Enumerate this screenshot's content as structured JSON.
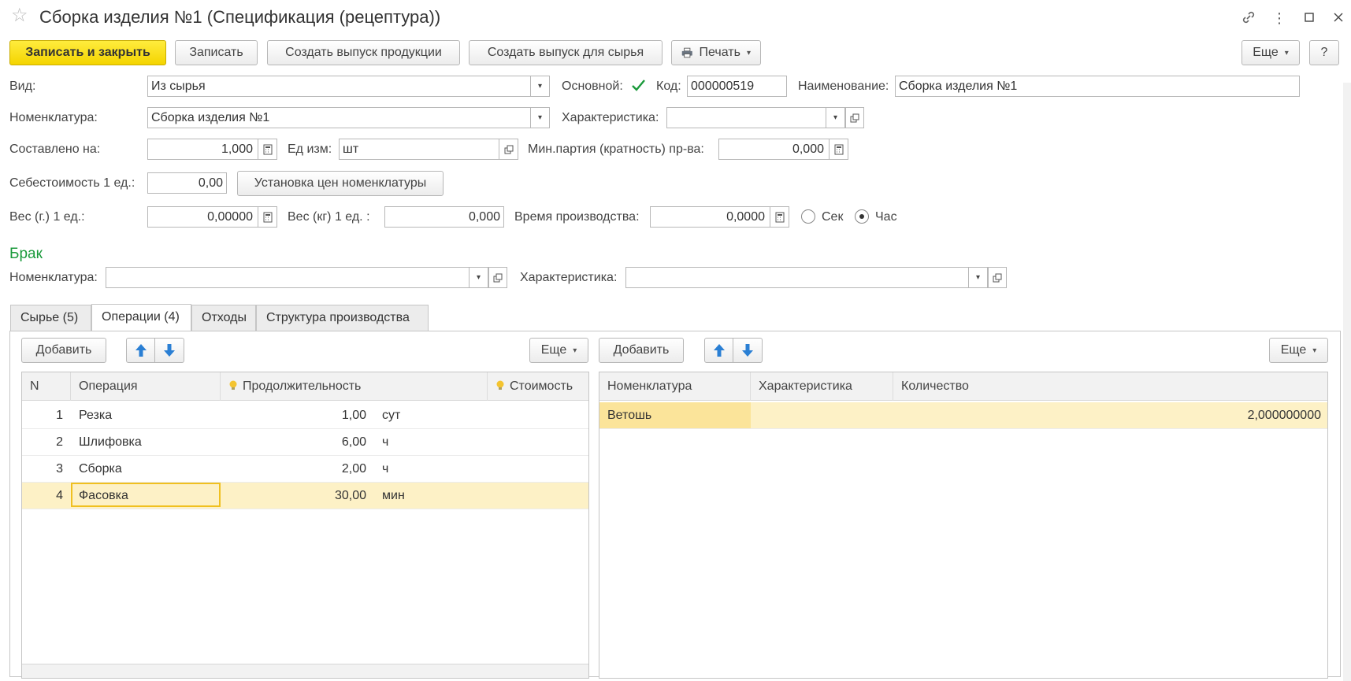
{
  "window": {
    "title": "Сборка изделия №1 (Спецификация (рецептура))"
  },
  "toolbar": {
    "save_close": "Записать и закрыть",
    "save": "Записать",
    "create_product_release": "Создать выпуск продукции",
    "create_raw_release": "Создать выпуск для сырья",
    "print": "Печать",
    "more": "Еще",
    "help": "?"
  },
  "form": {
    "vid_label": "Вид:",
    "vid_value": "Из сырья",
    "osnovnoy_label": "Основной:",
    "osnovnoy_checked": true,
    "kod_label": "Код:",
    "kod_value": "000000519",
    "naim_label": "Наименование:",
    "naim_value": "Сборка изделия №1",
    "nomen_label": "Номенклатура:",
    "nomen_value": "Сборка изделия №1",
    "char_label": "Характеристика:",
    "char_value": "",
    "sostavleno_label": "Составлено на:",
    "sostavleno_value": "1,000",
    "ed_label": "Ед изм:",
    "ed_value": "шт",
    "min_label": "Мин.партия (кратность) пр-ва:",
    "min_value": "0,000",
    "sebest_label": "Себестоимость 1 ед.:",
    "sebest_value": "0,00",
    "ustanovka_button": "Установка цен номенклатуры",
    "ves_g_label": "Вес (г.)  1 ед.:",
    "ves_g_value": "0,00000",
    "ves_kg_label": "Вес (кг) 1 ед.  :",
    "ves_kg_value": "0,000",
    "vremya_label": "Время производства:",
    "vremya_value": "0,0000",
    "radio_sec": "Сек",
    "radio_hour": "Час",
    "radio_selected": "Час"
  },
  "brak": {
    "title": "Брак",
    "nomen_label": "Номенклатура:",
    "nomen_value": "",
    "char_label": "Характеристика:",
    "char_value": ""
  },
  "tabs": [
    {
      "label": "Сырье (5)",
      "active": false
    },
    {
      "label": "Операции (4)",
      "active": true
    },
    {
      "label": "Отходы",
      "active": false
    },
    {
      "label": "Структура производства",
      "active": false
    }
  ],
  "operations": {
    "add_button": "Добавить",
    "more_button": "Еще",
    "columns": [
      "N",
      "Операция",
      "Продолжительность",
      "Стоимость"
    ],
    "rows": [
      {
        "n": "1",
        "op": "Резка",
        "dur": "1,00",
        "unit": "сут",
        "cost": ""
      },
      {
        "n": "2",
        "op": "Шлифовка",
        "dur": "6,00",
        "unit": "ч",
        "cost": ""
      },
      {
        "n": "3",
        "op": "Сборка",
        "dur": "2,00",
        "unit": "ч",
        "cost": ""
      },
      {
        "n": "4",
        "op": "Фасовка",
        "dur": "30,00",
        "unit": "мин",
        "cost": ""
      }
    ]
  },
  "materials": {
    "add_button": "Добавить",
    "more_button": "Еще",
    "columns": [
      "Номенклатура",
      "Характеристика",
      "Количество"
    ],
    "rows": [
      {
        "nomen": "Ветошь",
        "char": "",
        "qty": "2,000000000"
      }
    ]
  },
  "colors": {
    "primary_button": "#f4d400",
    "section_title": "#1a9a3b",
    "selected_row": "#fdf1c6",
    "arrow_blue": "#2a7fd4"
  }
}
